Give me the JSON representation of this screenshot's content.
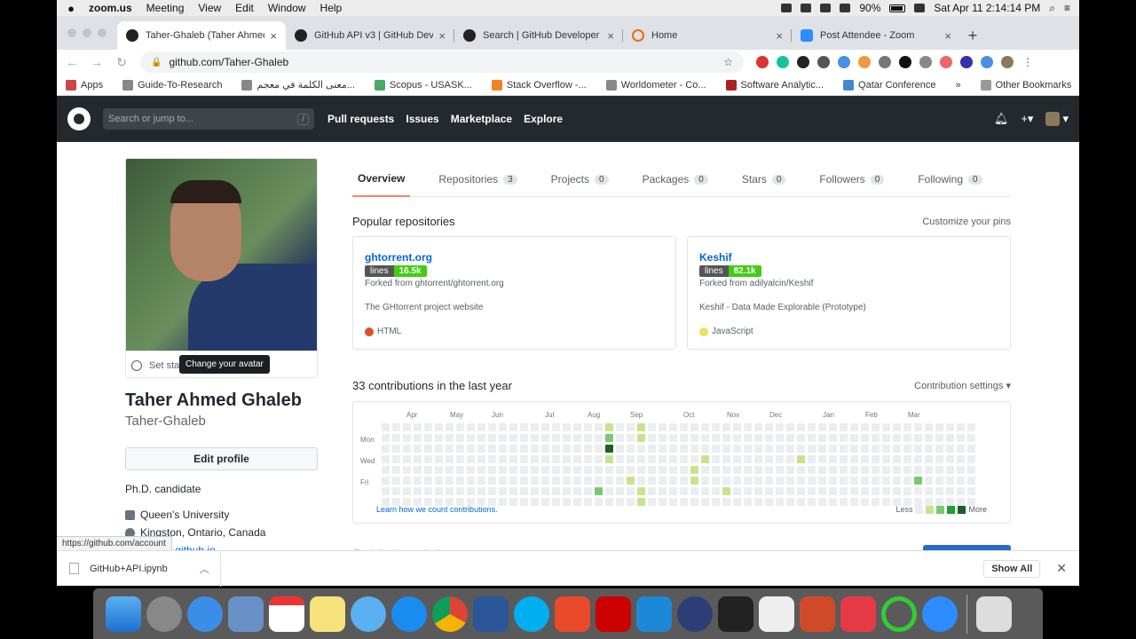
{
  "menubar": {
    "app_name": "zoom.us",
    "items": [
      "Meeting",
      "View",
      "Edit",
      "Window",
      "Help"
    ],
    "battery": "90%",
    "datetime": "Sat Apr 11  2:14:14 PM"
  },
  "browser": {
    "tabs": [
      {
        "title": "Taher-Ghaleb (Taher Ahmed G",
        "icon": "github-icon",
        "active": true
      },
      {
        "title": "GitHub API v3 | GitHub Develo",
        "icon": "github-icon",
        "active": false
      },
      {
        "title": "Search | GitHub Developer Gu",
        "icon": "github-icon",
        "active": false
      },
      {
        "title": "Home",
        "icon": "home-icon",
        "active": false
      },
      {
        "title": "Post Attendee - Zoom",
        "icon": "zoom-icon",
        "active": false
      }
    ],
    "url": "github.com/Taher-Ghaleb",
    "bookmarks": [
      "Apps",
      "Guide-To-Research",
      "معنى الكلمة في معجم...",
      "Scopus - USASK...",
      "Stack Overflow -...",
      "Worldometer - Co...",
      "Software Analytic...",
      "Qatar Conference"
    ],
    "other_bookmarks": "Other Bookmarks"
  },
  "github": {
    "search_placeholder": "Search or jump to...",
    "search_shortcut": "/",
    "nav": [
      "Pull requests",
      "Issues",
      "Marketplace",
      "Explore"
    ]
  },
  "profile": {
    "set_status": "Set sta",
    "avatar_tooltip": "Change your avatar",
    "full_name": "Taher Ahmed Ghaleb",
    "username": "Taher-Ghaleb",
    "edit_profile": "Edit profile",
    "bio": "Ph.D. candidate",
    "organization": "Queen's University",
    "location": "Kingston, Ontario, Canada",
    "website": "ghaleb.github.io",
    "status_url": "https://github.com/account"
  },
  "profile_tabs": [
    {
      "label": "Overview",
      "count": null,
      "active": true
    },
    {
      "label": "Repositories",
      "count": "3"
    },
    {
      "label": "Projects",
      "count": "0"
    },
    {
      "label": "Packages",
      "count": "0"
    },
    {
      "label": "Stars",
      "count": "0"
    },
    {
      "label": "Followers",
      "count": "0"
    },
    {
      "label": "Following",
      "count": "0"
    }
  ],
  "popular": {
    "heading": "Popular repositories",
    "customize": "Customize your pins",
    "repos": [
      {
        "name": "ghtorrent.org",
        "badge_label": "lines",
        "badge_value": "16.5k",
        "forked_from": "Forked from ghtorrent/ghtorrent.org",
        "description": "The GHtorrent project website",
        "language": "HTML",
        "language_color": "#e34c26"
      },
      {
        "name": "Keshif",
        "badge_label": "lines",
        "badge_value": "82.1k",
        "forked_from": "Forked from adilyalcin/Keshif",
        "description": "Keshif - Data Made Explorable (Prototype)",
        "language": "JavaScript",
        "language_color": "#f1e05a"
      }
    ]
  },
  "contributions": {
    "heading": "33 contributions in the last year",
    "settings": "Contribution settings ▾",
    "months": [
      "Apr",
      "May",
      "Jun",
      "Jul",
      "Aug",
      "Sep",
      "Oct",
      "Nov",
      "Dec",
      "Jan",
      "Feb",
      "Mar"
    ],
    "days": [
      "Mon",
      "Wed",
      "Fri"
    ],
    "learn_link": "Learn how we count contributions.",
    "legend_less": "Less",
    "legend_more": "More",
    "colors": [
      "#ebedf0",
      "#c6e48b",
      "#7bc96f",
      "#239a3b",
      "#196127"
    ]
  },
  "activity_partial": "Contribution activity",
  "downloads": {
    "file": "GitHub+API.ipynb",
    "show_all": "Show All"
  }
}
